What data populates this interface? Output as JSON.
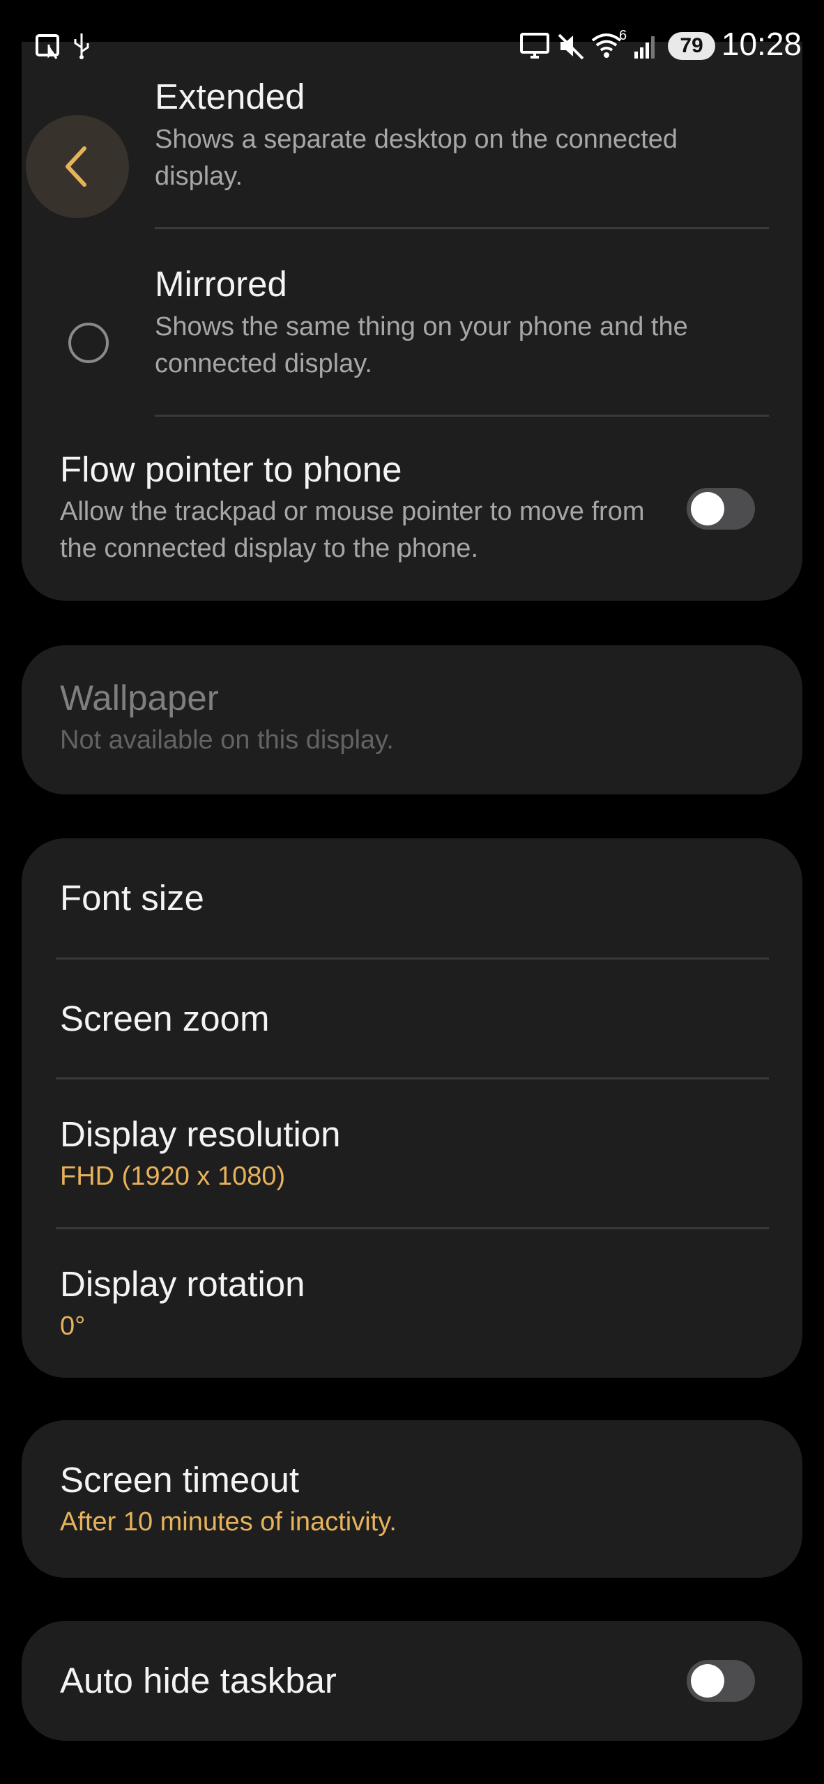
{
  "status_bar": {
    "time": "10:28",
    "battery": "79",
    "wifi_badge": "6",
    "icons": [
      "screen-cast-icon",
      "usb-icon",
      "display-icon",
      "mute-icon",
      "wifi-icon",
      "signal-icon"
    ]
  },
  "colors": {
    "background": "#000000",
    "card": "#1e1e1e",
    "accent": "#e7b25c",
    "text_primary": "#f4f4f4",
    "text_secondary": "#a7a7a7"
  },
  "display_mode": {
    "extended": {
      "title": "Extended",
      "description": "Shows a separate desktop on the connected display."
    },
    "mirrored": {
      "title": "Mirrored",
      "description": "Shows the same thing on your phone and the connected display."
    },
    "flow_pointer": {
      "title": "Flow pointer to phone",
      "description": "Allow the trackpad or mouse pointer to move from the connected display to the phone."
    }
  },
  "wallpaper": {
    "title": "Wallpaper",
    "description": "Not available on this display."
  },
  "display_settings": {
    "font_size": "Font size",
    "screen_zoom": "Screen zoom",
    "resolution": {
      "title": "Display resolution",
      "value": "FHD (1920 x 1080)"
    },
    "rotation": {
      "title": "Display rotation",
      "value": "0°"
    }
  },
  "screen_timeout": {
    "title": "Screen timeout",
    "value": "After 10 minutes of inactivity."
  },
  "taskbar": {
    "title": "Auto hide taskbar"
  }
}
